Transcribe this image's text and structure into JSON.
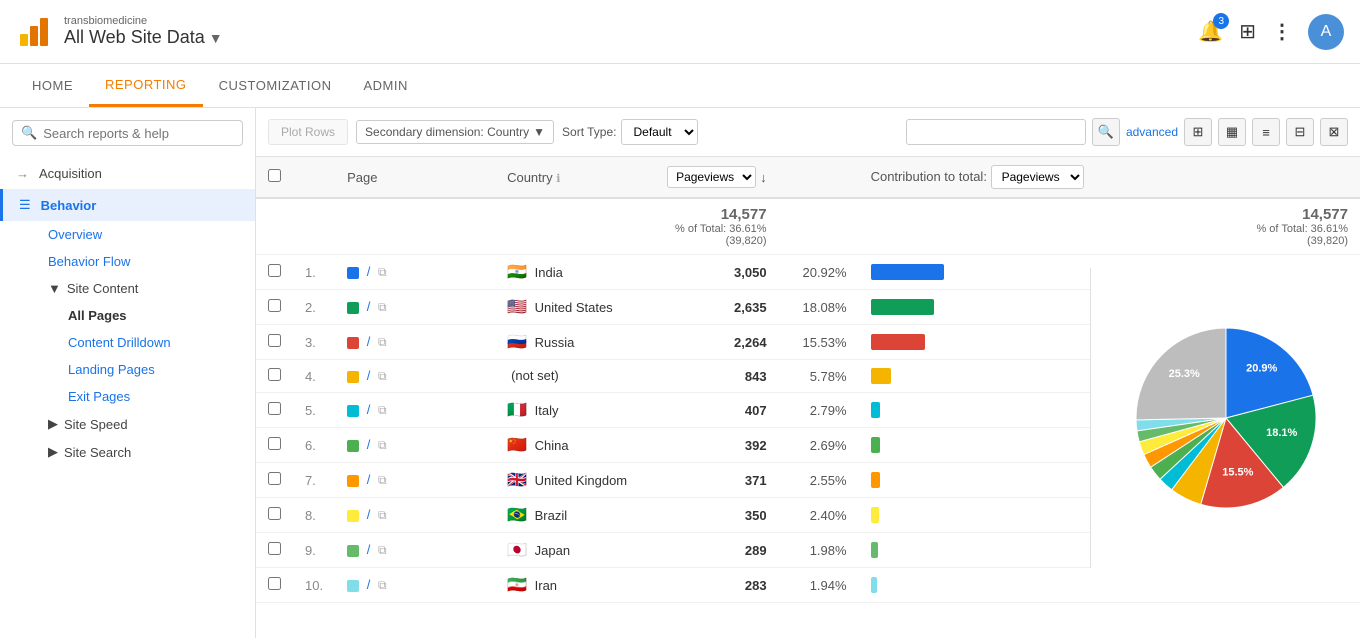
{
  "header": {
    "site_name": "transbiomedicine",
    "site_title": "All Web Site Data",
    "dropdown_icon": "▼",
    "bell_badge": "3",
    "avatar_letter": "A"
  },
  "nav": {
    "items": [
      {
        "label": "HOME",
        "active": false
      },
      {
        "label": "REPORTING",
        "active": true
      },
      {
        "label": "CUSTOMIZATION",
        "active": false
      },
      {
        "label": "ADMIN",
        "active": false
      }
    ]
  },
  "sidebar": {
    "search_placeholder": "Search reports & help",
    "items": [
      {
        "label": "Acquisition",
        "icon": "→",
        "active": false,
        "type": "item"
      },
      {
        "label": "Behavior",
        "icon": "☰",
        "active": true,
        "type": "item"
      },
      {
        "label": "Overview",
        "type": "sub",
        "active": false
      },
      {
        "label": "Behavior Flow",
        "type": "sub",
        "active": false
      },
      {
        "label": "Site Content",
        "type": "group",
        "active": false
      },
      {
        "label": "All Pages",
        "type": "subsub",
        "active": true
      },
      {
        "label": "Content Drilldown",
        "type": "subsub",
        "active": false
      },
      {
        "label": "Landing Pages",
        "type": "subsub",
        "active": false
      },
      {
        "label": "Exit Pages",
        "type": "subsub",
        "active": false
      },
      {
        "label": "Site Speed",
        "type": "group",
        "active": false
      },
      {
        "label": "Site Search",
        "type": "group",
        "active": false
      }
    ]
  },
  "toolbar": {
    "plot_rows_label": "Plot Rows",
    "secondary_dim_label": "Secondary dimension: Country",
    "sort_type_label": "Sort Type:",
    "sort_default": "Default",
    "advanced_label": "advanced"
  },
  "table": {
    "headers": {
      "page": "Page",
      "country": "Country",
      "pageviews": "Pageviews",
      "contribution": "Contribution to total:",
      "contribution_select": "Pageviews"
    },
    "summary": {
      "pv_total": "14,577",
      "pv_pct": "% of Total: 36.61% (39,820)",
      "pv2_total": "14,577",
      "pv2_pct": "% of Total: 36.61%",
      "pv2_sub": "(39,820)"
    },
    "rows": [
      {
        "num": "1.",
        "color": "#1a73e8",
        "page": "/",
        "country_flag": "🇮🇳",
        "country": "India",
        "pageviews": "3,050",
        "pct": "20.92%"
      },
      {
        "num": "2.",
        "color": "#0f9d58",
        "page": "/",
        "country_flag": "🇺🇸",
        "country": "United States",
        "pageviews": "2,635",
        "pct": "18.08%"
      },
      {
        "num": "3.",
        "color": "#db4437",
        "page": "/",
        "country_flag": "🇷🇺",
        "country": "Russia",
        "pageviews": "2,264",
        "pct": "15.53%"
      },
      {
        "num": "4.",
        "color": "#f4b400",
        "page": "/",
        "country_flag": "",
        "country": "(not set)",
        "pageviews": "843",
        "pct": "5.78%"
      },
      {
        "num": "5.",
        "color": "#00bcd4",
        "page": "/",
        "country_flag": "🇮🇹",
        "country": "Italy",
        "pageviews": "407",
        "pct": "2.79%"
      },
      {
        "num": "6.",
        "color": "#4caf50",
        "page": "/",
        "country_flag": "🇨🇳",
        "country": "China",
        "pageviews": "392",
        "pct": "2.69%"
      },
      {
        "num": "7.",
        "color": "#ff9800",
        "page": "/",
        "country_flag": "🇬🇧",
        "country": "United Kingdom",
        "pageviews": "371",
        "pct": "2.55%"
      },
      {
        "num": "8.",
        "color": "#ffeb3b",
        "page": "/",
        "country_flag": "🇧🇷",
        "country": "Brazil",
        "pageviews": "350",
        "pct": "2.40%"
      },
      {
        "num": "9.",
        "color": "#66bb6a",
        "page": "/",
        "country_flag": "🇯🇵",
        "country": "Japan",
        "pageviews": "289",
        "pct": "1.98%"
      },
      {
        "num": "10.",
        "color": "#80deea",
        "page": "/",
        "country_flag": "🇮🇷",
        "country": "Iran",
        "pageviews": "283",
        "pct": "1.94%"
      }
    ]
  },
  "pie_chart": {
    "segments": [
      {
        "label": "India",
        "pct": 20.92,
        "color": "#1a73e8",
        "label_pct": "20.9%"
      },
      {
        "label": "United States",
        "pct": 18.08,
        "color": "#0f9d58",
        "label_pct": "18.1%"
      },
      {
        "label": "Russia",
        "pct": 15.53,
        "color": "#db4437",
        "label_pct": "15.5%"
      },
      {
        "label": "not set",
        "pct": 5.78,
        "color": "#f4b400",
        "label_pct": ""
      },
      {
        "label": "Italy",
        "pct": 2.79,
        "color": "#00bcd4",
        "label_pct": ""
      },
      {
        "label": "China",
        "pct": 2.69,
        "color": "#4caf50",
        "label_pct": ""
      },
      {
        "label": "UK",
        "pct": 2.55,
        "color": "#ff9800",
        "label_pct": ""
      },
      {
        "label": "Brazil",
        "pct": 2.4,
        "color": "#ffeb3b",
        "label_pct": ""
      },
      {
        "label": "Japan",
        "pct": 1.98,
        "color": "#66bb6a",
        "label_pct": ""
      },
      {
        "label": "Iran",
        "pct": 1.94,
        "color": "#80deea",
        "label_pct": ""
      },
      {
        "label": "Other",
        "pct": 25.34,
        "color": "#bdbdbd",
        "label_pct": "25.3%"
      }
    ]
  },
  "icons": {
    "search": "🔍",
    "bell": "🔔",
    "grid": "⊞",
    "dots_vert": "⋮",
    "chevron_down": "▼",
    "copy": "⧉",
    "sort_down": "↓",
    "table_icon": "⊞",
    "bar_icon": "▦",
    "list_icon": "≡",
    "filter_icon": "⊟",
    "pivot_icon": "⊠",
    "info": "ℹ"
  }
}
